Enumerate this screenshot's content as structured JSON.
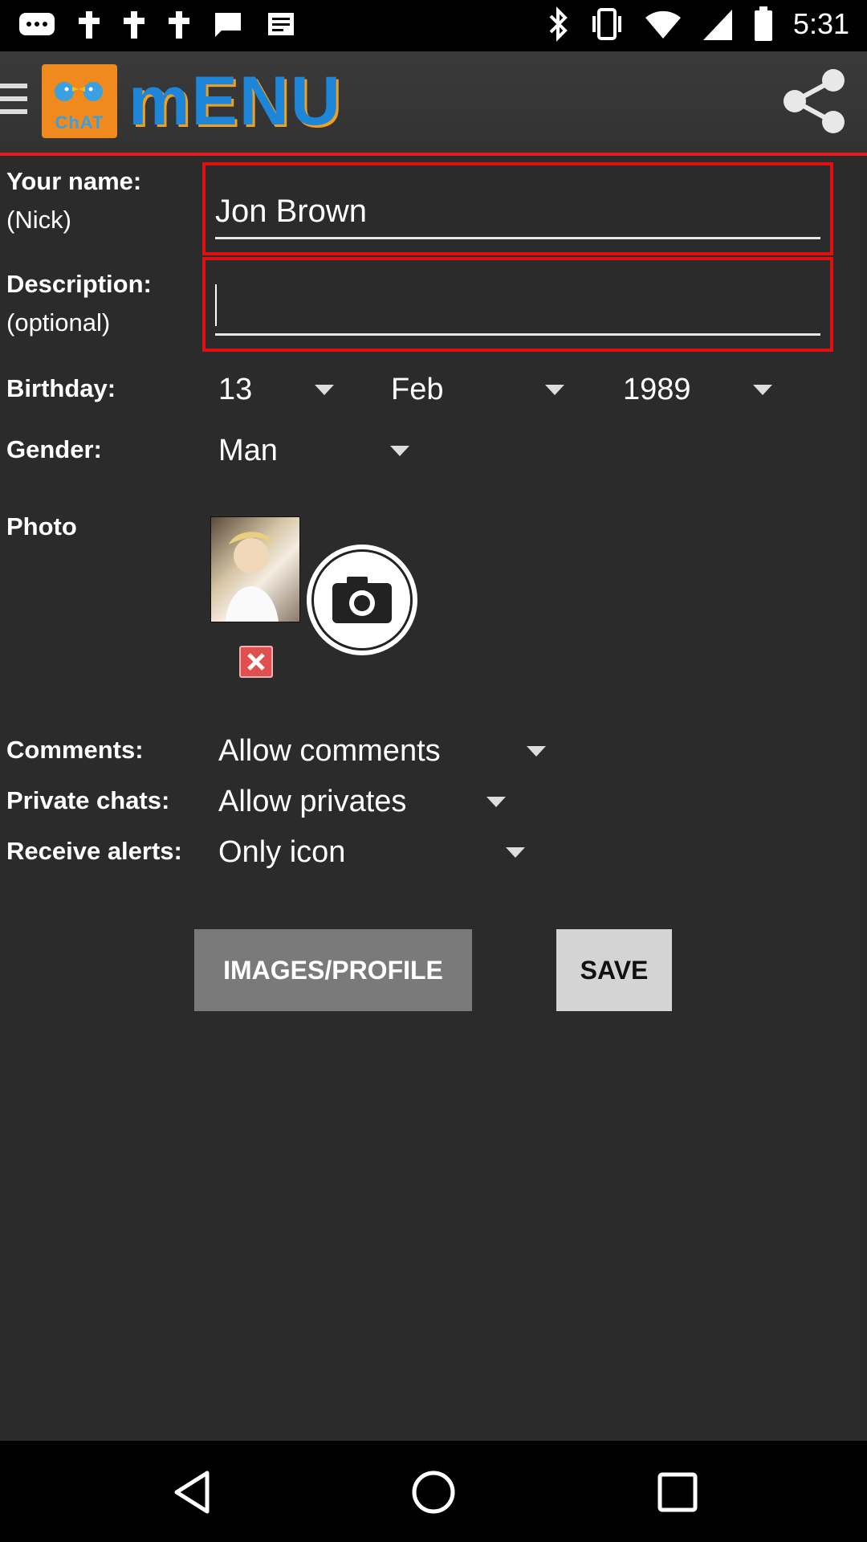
{
  "status_bar": {
    "time": "5:31"
  },
  "app_bar": {
    "logo_text": "ChAT",
    "title": "mENU"
  },
  "form": {
    "name_label": "Your name:",
    "name_sub": "(Nick)",
    "name_value": "Jon Brown",
    "description_label": "Description:",
    "description_sub": "(optional)",
    "description_value": "",
    "birthday_label": "Birthday:",
    "birthday_day": "13",
    "birthday_month": "Feb",
    "birthday_year": "1989",
    "gender_label": "Gender:",
    "gender_value": "Man",
    "photo_label": "Photo",
    "comments_label": "Comments:",
    "comments_value": "Allow comments",
    "private_label": "Private chats:",
    "private_value": "Allow privates",
    "alerts_label": "Receive alerts:",
    "alerts_value": "Only icon"
  },
  "buttons": {
    "images_profile": "IMAGES/PROFILE",
    "save": "SAVE"
  },
  "colors": {
    "accent_red": "#e01010",
    "brand_blue": "#1d86d8",
    "logo_orange": "#f08a1c"
  }
}
